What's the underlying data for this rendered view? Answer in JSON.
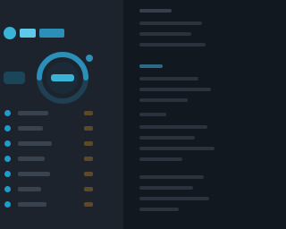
{
  "app": {
    "logo": "logo-icon"
  },
  "gauge": {
    "icon": "gauge-icon",
    "accent": "#3ab3d8",
    "track": "#1f3f52"
  },
  "list": {
    "item_count": 7,
    "dot_color": "#1f9ccc"
  },
  "colors": {
    "left_panel": "#1c232d",
    "background": "#121820",
    "accent": "#3ab3d8"
  }
}
